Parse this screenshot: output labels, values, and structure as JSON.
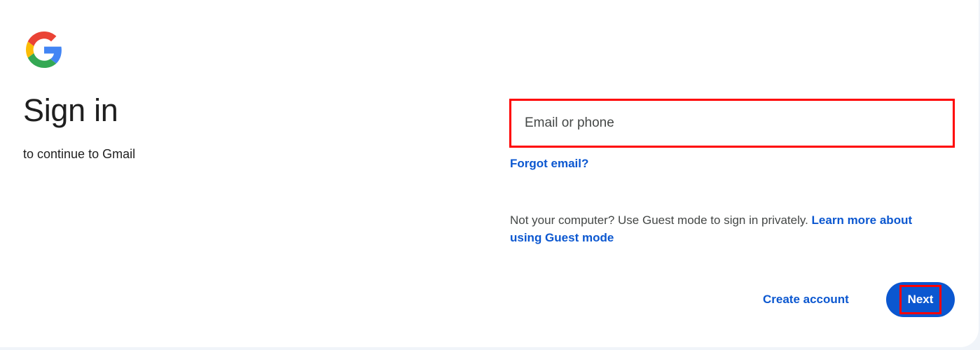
{
  "header": {
    "logo_icon": "google-g-logo-icon",
    "title": "Sign in",
    "subtitle": "to continue to Gmail"
  },
  "form": {
    "email_placeholder": "Email or phone",
    "email_value": "",
    "forgot_email_label": "Forgot email?",
    "guest_note_text": "Not your computer? Use Guest mode to sign in privately. ",
    "guest_link_label": "Learn more about using Guest mode",
    "create_account_label": "Create account",
    "next_label": "Next"
  },
  "colors": {
    "page_background": "#f0f4f9",
    "card_background": "#ffffff",
    "link_blue": "#0b57d0",
    "primary_button": "#0b57d0",
    "highlight_red": "#ff0000",
    "google_blue": "#4285f4",
    "google_red": "#ea4335",
    "google_yellow": "#fbbc05",
    "google_green": "#34a853"
  }
}
